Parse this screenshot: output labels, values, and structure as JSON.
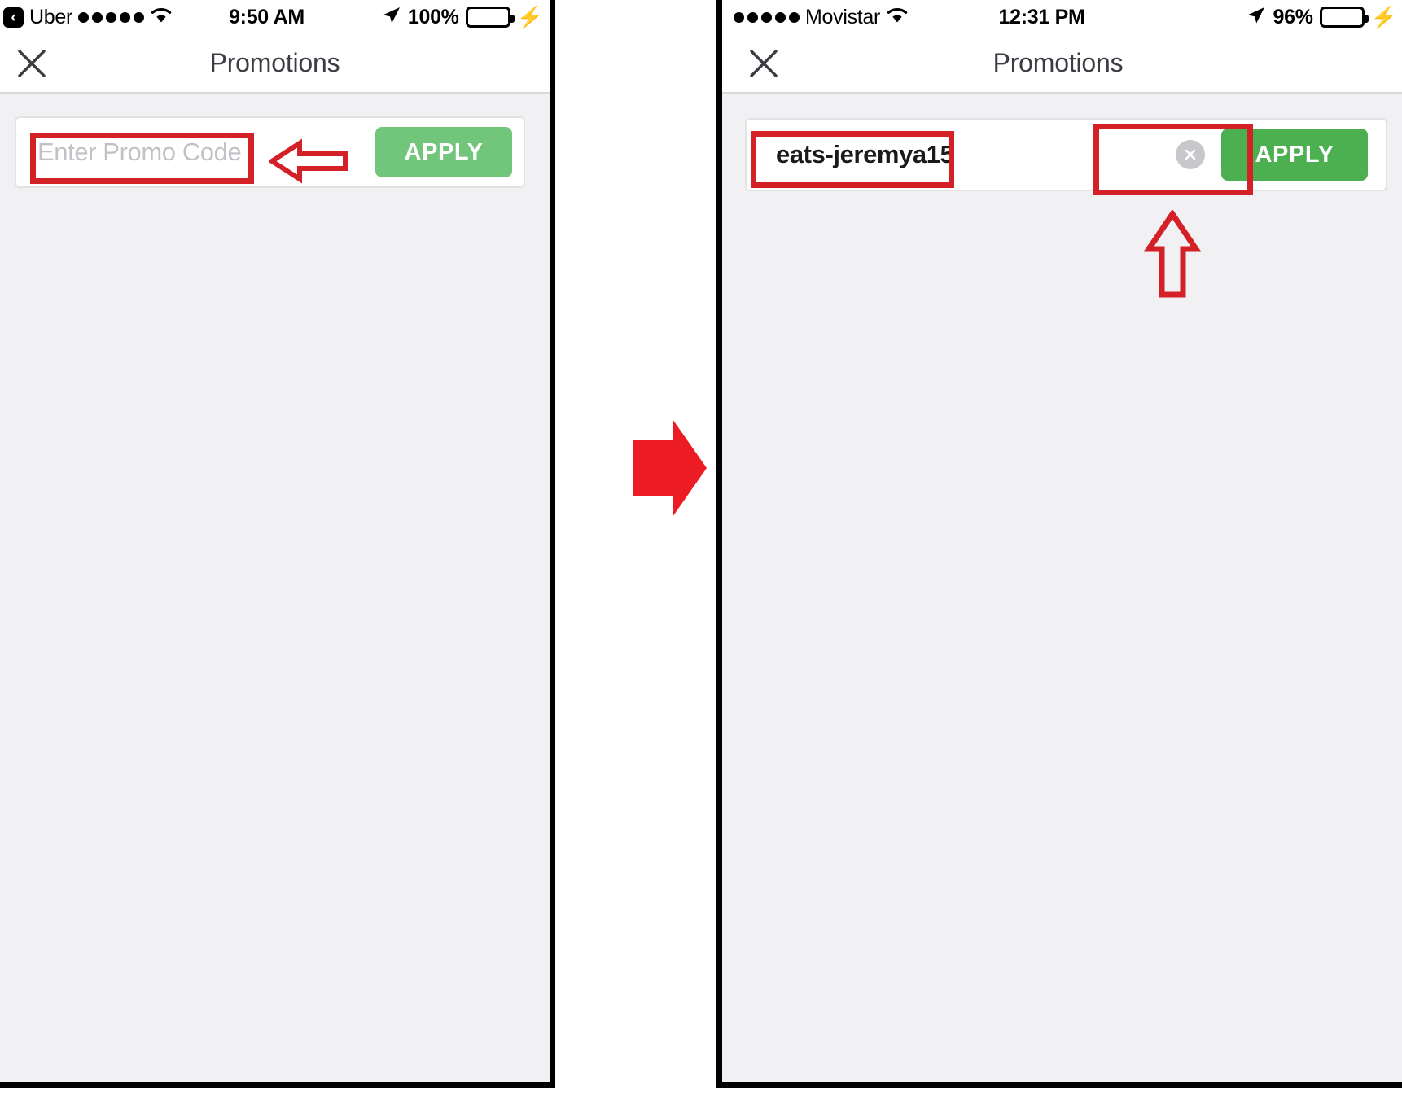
{
  "screens": [
    {
      "id": "before",
      "status_bar": {
        "back_chip": "‹",
        "carrier": "Uber",
        "signal_dots": 5,
        "wifi_icon": "wifi-icon",
        "time": "9:50 AM",
        "location_icon": "location-arrow-icon",
        "battery_percent": "100%",
        "battery_fill_percent": 100,
        "charging_icon": "lightning-bolt-icon"
      },
      "nav": {
        "close_icon": "close-icon",
        "title": "Promotions"
      },
      "promo": {
        "placeholder": "Enter Promo Code",
        "value": "",
        "apply_label": "APPLY",
        "apply_enabled": false,
        "clear_icon_visible": false
      }
    },
    {
      "id": "after",
      "status_bar": {
        "carrier": "Movistar",
        "signal_dots": 5,
        "wifi_icon": "wifi-icon",
        "time": "12:31 PM",
        "location_icon": "location-arrow-icon",
        "battery_percent": "96%",
        "battery_fill_percent": 96,
        "charging_icon": "lightning-bolt-icon"
      },
      "nav": {
        "close_icon": "close-icon",
        "title": "Promotions"
      },
      "promo": {
        "placeholder": "Enter Promo Code",
        "value": "eats-jeremya15",
        "apply_label": "APPLY",
        "apply_enabled": true,
        "clear_icon_visible": true,
        "clear_icon": "clear-circle-icon"
      }
    }
  ],
  "annotations": {
    "color": "#d42027",
    "highlight_input_before": "Enter Promo Code field",
    "highlight_input_after": "eats-jeremya15 field",
    "highlight_apply_after": "APPLY button",
    "arrow_to_input": "left-pointing-arrow",
    "arrow_to_apply": "up-pointing-arrow",
    "arrow_flow": "right-pointing-arrow"
  },
  "colors": {
    "apply_disabled_green": "#72c67b",
    "apply_enabled_green": "#4caf50",
    "battery_green": "#4CD964",
    "annotation_red": "#d42027",
    "content_background": "#f1f1f3",
    "placeholder_gray": "#c2c2c6"
  }
}
